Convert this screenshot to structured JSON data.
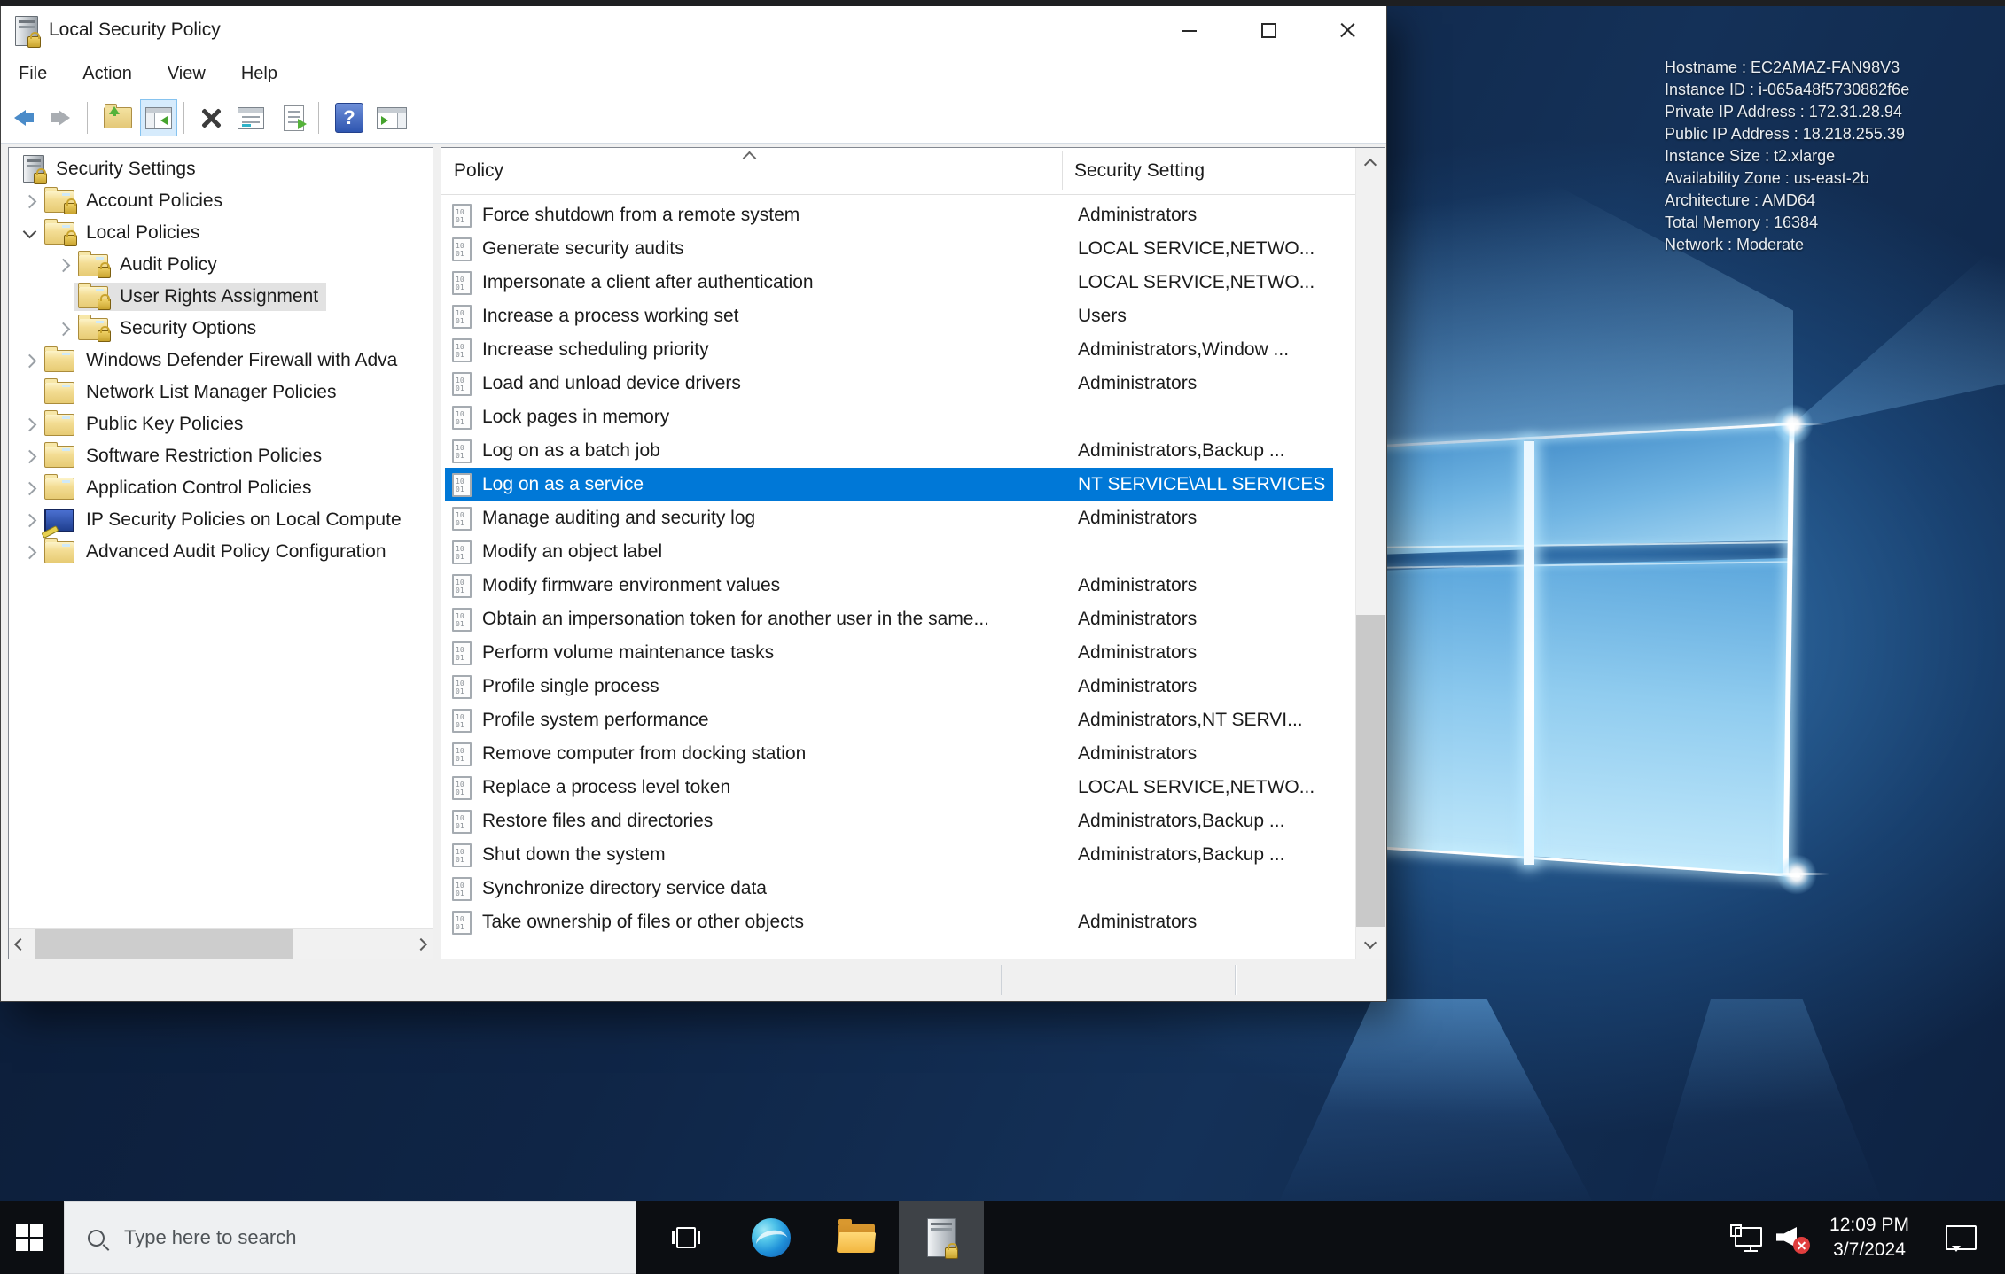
{
  "colors": {
    "selection_blue": "#0078d7",
    "tree_selection_gray": "#e2e2e2",
    "desktop_navy": "#0e2140",
    "taskbar_black": "#0c0e12",
    "folder_yellow": "#e7cb74"
  },
  "titlebar": {
    "title": "Local Security Policy"
  },
  "window_controls": {
    "buttons": [
      "minimize",
      "maximize",
      "close"
    ]
  },
  "menubar": {
    "items": [
      "File",
      "Action",
      "View",
      "Help"
    ]
  },
  "toolbar": {
    "help_glyph": "?",
    "buttons": [
      "back",
      "forward",
      "up-one-level",
      "show-console-tree",
      "delete",
      "properties",
      "export-list",
      "help",
      "show-action-pane"
    ]
  },
  "tree": {
    "items": [
      {
        "label": "Security Settings"
      },
      {
        "label": "Account Policies"
      },
      {
        "label": "Local Policies"
      },
      {
        "label": "Audit Policy"
      },
      {
        "label": "User Rights Assignment"
      },
      {
        "label": "Security Options"
      },
      {
        "label": "Windows Defender Firewall with Adva"
      },
      {
        "label": "Network List Manager Policies"
      },
      {
        "label": "Public Key Policies"
      },
      {
        "label": "Software Restriction Policies"
      },
      {
        "label": "Application Control Policies"
      },
      {
        "label": "IP Security Policies on Local Compute"
      },
      {
        "label": "Advanced Audit Policy Configuration"
      }
    ]
  },
  "list": {
    "columns": {
      "policy": "Policy",
      "setting": "Security Setting"
    },
    "rows": [
      {
        "policy": "Force shutdown from a remote system",
        "setting": "Administrators"
      },
      {
        "policy": "Generate security audits",
        "setting": "LOCAL SERVICE,NETWO..."
      },
      {
        "policy": "Impersonate a client after authentication",
        "setting": "LOCAL SERVICE,NETWO..."
      },
      {
        "policy": "Increase a process working set",
        "setting": "Users"
      },
      {
        "policy": "Increase scheduling priority",
        "setting": "Administrators,Window ..."
      },
      {
        "policy": "Load and unload device drivers",
        "setting": "Administrators"
      },
      {
        "policy": "Lock pages in memory",
        "setting": ""
      },
      {
        "policy": "Log on as a batch job",
        "setting": "Administrators,Backup ..."
      },
      {
        "policy": "Log on as a service",
        "setting": "NT SERVICE\\ALL SERVICES"
      },
      {
        "policy": "Manage auditing and security log",
        "setting": "Administrators"
      },
      {
        "policy": "Modify an object label",
        "setting": ""
      },
      {
        "policy": "Modify firmware environment values",
        "setting": "Administrators"
      },
      {
        "policy": "Obtain an impersonation token for another user in the same...",
        "setting": "Administrators"
      },
      {
        "policy": "Perform volume maintenance tasks",
        "setting": "Administrators"
      },
      {
        "policy": "Profile single process",
        "setting": "Administrators"
      },
      {
        "policy": "Profile system performance",
        "setting": "Administrators,NT SERVI..."
      },
      {
        "policy": "Remove computer from docking station",
        "setting": "Administrators"
      },
      {
        "policy": "Replace a process level token",
        "setting": "LOCAL SERVICE,NETWO..."
      },
      {
        "policy": "Restore files and directories",
        "setting": "Administrators,Backup ..."
      },
      {
        "policy": "Shut down the system",
        "setting": "Administrators,Backup ..."
      },
      {
        "policy": "Synchronize directory service data",
        "setting": ""
      },
      {
        "policy": "Take ownership of files or other objects",
        "setting": "Administrators"
      }
    ]
  },
  "desktop": {
    "sysinfo_lines": [
      "Hostname : EC2AMAZ-FAN98V3",
      "Instance ID : i-065a48f5730882f6e",
      "Private IP Address : 172.31.28.94",
      "Public IP Address : 18.218.255.39",
      "Instance Size : t2.xlarge",
      "Availability Zone : us-east-2b",
      "Architecture : AMD64",
      "Total Memory : 16384",
      "Network : Moderate"
    ]
  },
  "taskbar": {
    "search_placeholder": "Type here to search",
    "clock_time": "12:09 PM",
    "clock_date": "3/7/2024",
    "icons": [
      "start",
      "search",
      "task-view",
      "edge",
      "file-explorer",
      "local-security-policy",
      "network",
      "volume-muted",
      "clock",
      "action-center"
    ]
  }
}
